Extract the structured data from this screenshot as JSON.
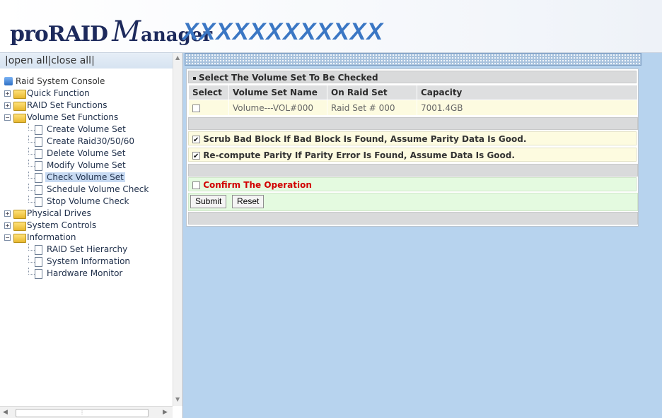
{
  "header": {
    "logo_pro": "proRAID",
    "logo_m": "M",
    "logo_anager": "anager",
    "model": "XXXXXXXXXXXX"
  },
  "nav": {
    "open_all": "open all",
    "close_all": "close all",
    "separator": "|",
    "root": "Raid System Console",
    "items": [
      {
        "type": "folder",
        "label": "Quick Function",
        "expanded": false
      },
      {
        "type": "folder",
        "label": "RAID Set Functions",
        "expanded": false
      },
      {
        "type": "folder",
        "label": "Volume Set Functions",
        "expanded": true
      },
      {
        "type": "leaf",
        "label": "Create Volume Set"
      },
      {
        "type": "leaf",
        "label": "Create Raid30/50/60"
      },
      {
        "type": "leaf",
        "label": "Delete Volume Set"
      },
      {
        "type": "leaf",
        "label": "Modify Volume Set"
      },
      {
        "type": "leaf",
        "label": "Check Volume Set",
        "selected": true
      },
      {
        "type": "leaf",
        "label": "Schedule Volume Check"
      },
      {
        "type": "leaf",
        "label": "Stop Volume Check"
      },
      {
        "type": "folder",
        "label": "Physical Drives",
        "expanded": false
      },
      {
        "type": "folder",
        "label": "System Controls",
        "expanded": false
      },
      {
        "type": "folder",
        "label": "Information",
        "expanded": true
      },
      {
        "type": "leaf",
        "label": "RAID Set Hierarchy"
      },
      {
        "type": "leaf",
        "label": "System Information"
      },
      {
        "type": "leaf",
        "label": "Hardware Monitor"
      }
    ]
  },
  "panel": {
    "title": "Select The Volume Set To Be Checked",
    "columns": [
      "Select",
      "Volume Set Name",
      "On Raid Set",
      "Capacity"
    ],
    "rows": [
      {
        "checked": false,
        "name": "Volume---VOL#000",
        "raid_set": "Raid Set # 000",
        "capacity": "7001.4GB"
      }
    ],
    "option_scrub": "Scrub Bad Block If Bad Block Is Found, Assume Parity Data Is Good.",
    "option_scrub_checked": true,
    "option_recompute": "Re-compute Parity If Parity Error Is Found, Assume Data Is Good.",
    "option_recompute_checked": true,
    "confirm_label": "Confirm The Operation",
    "confirm_checked": false,
    "submit_label": "Submit",
    "reset_label": "Reset"
  },
  "colors": {
    "main_bg": "#b7d3ee",
    "confirm_text": "#d10000",
    "row_bg": "#fdfbe0",
    "confirm_bg": "#e4fae0"
  }
}
